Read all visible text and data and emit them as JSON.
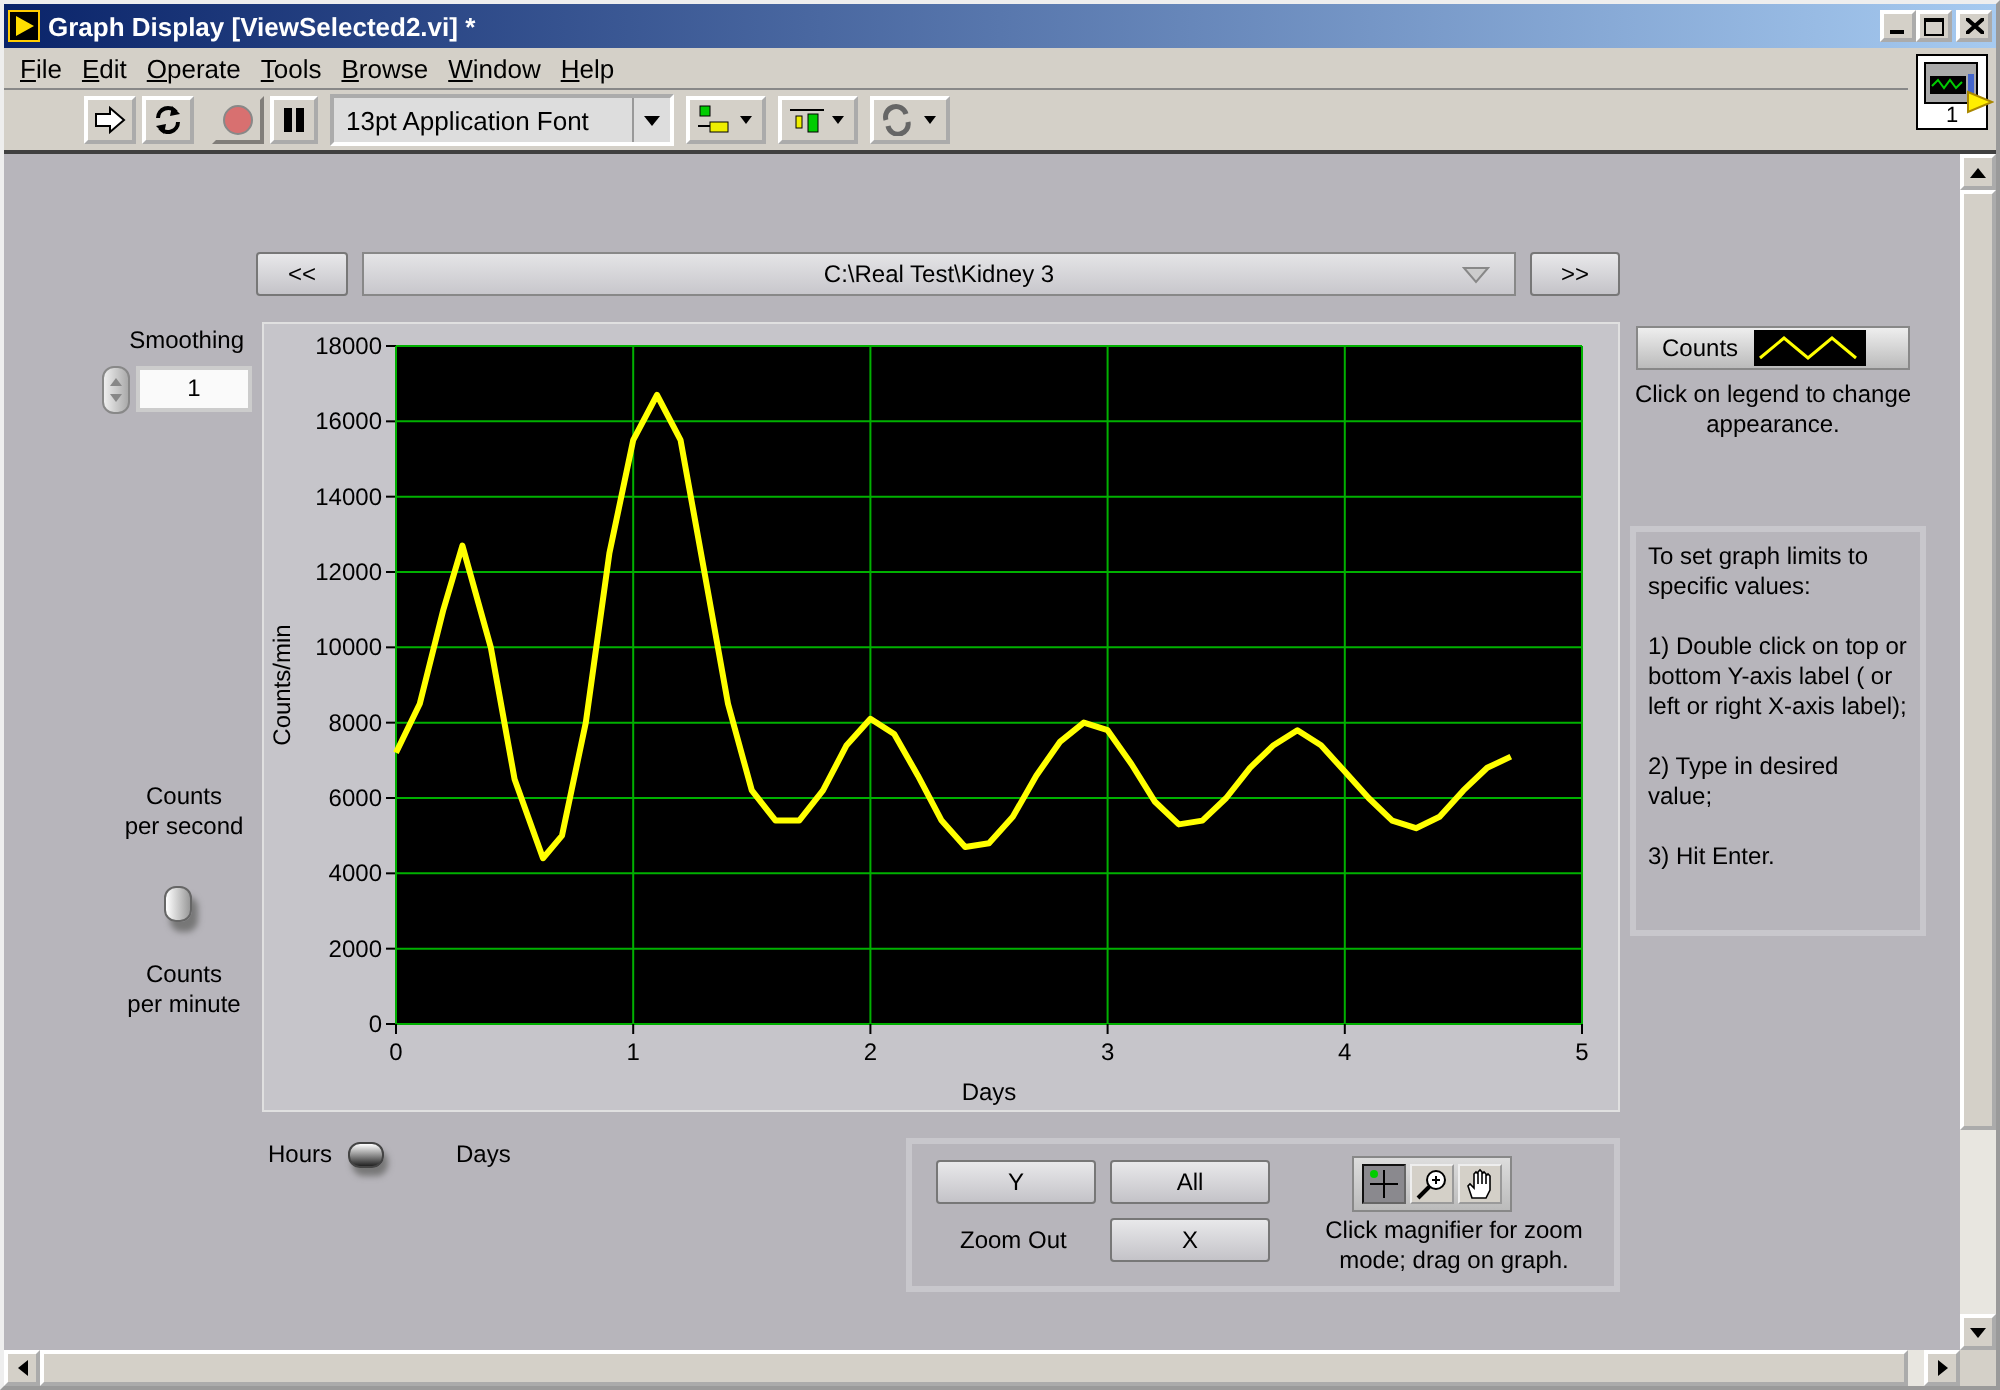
{
  "window": {
    "title": "Graph Display [ViewSelected2.vi] *"
  },
  "menu": [
    "File",
    "Edit",
    "Operate",
    "Tools",
    "Browse",
    "Window",
    "Help"
  ],
  "toolbar": {
    "font": "13pt Application Font",
    "running": false
  },
  "vi_icon": {
    "label": "1"
  },
  "navigator": {
    "prev": "<<",
    "path": "C:\\Real Test\\Kidney 3",
    "next": ">>"
  },
  "smoothing": {
    "label": "Smoothing",
    "value": "1"
  },
  "units_switch": {
    "top_label": "Counts\nper second",
    "bottom_label": "Counts\nper minute",
    "on": false
  },
  "time_switch": {
    "left_label": "Hours",
    "right_label": "Days",
    "on": false
  },
  "graph": {
    "chart_data": {
      "type": "line",
      "grid": true,
      "xlabel": "Days",
      "ylabel": "Counts/min",
      "xlim": [
        0,
        5
      ],
      "ylim": [
        0,
        18000
      ],
      "xticks": [
        0,
        1,
        2,
        3,
        4,
        5
      ],
      "yticks": [
        0,
        2000,
        4000,
        6000,
        8000,
        10000,
        12000,
        14000,
        16000,
        18000
      ],
      "x": [
        0,
        0.1,
        0.2,
        0.28,
        0.4,
        0.5,
        0.62,
        0.7,
        0.8,
        0.9,
        1.0,
        1.1,
        1.2,
        1.3,
        1.4,
        1.5,
        1.6,
        1.7,
        1.8,
        1.9,
        2.0,
        2.1,
        2.2,
        2.3,
        2.4,
        2.5,
        2.6,
        2.7,
        2.8,
        2.9,
        3.0,
        3.1,
        3.2,
        3.3,
        3.4,
        3.5,
        3.6,
        3.7,
        3.8,
        3.9,
        4.0,
        4.1,
        4.2,
        4.3,
        4.4,
        4.5,
        4.6,
        4.7
      ],
      "series": [
        {
          "name": "Counts",
          "color": "#ffff00",
          "values": [
            7200,
            8500,
            11000,
            12700,
            10000,
            6500,
            4400,
            5000,
            8000,
            12500,
            15500,
            16700,
            15500,
            12000,
            8500,
            6200,
            5400,
            5400,
            6200,
            7400,
            8100,
            7700,
            6600,
            5400,
            4700,
            4800,
            5500,
            6600,
            7500,
            8000,
            7800,
            6900,
            5900,
            5300,
            5400,
            6000,
            6800,
            7400,
            7800,
            7400,
            6700,
            6000,
            5400,
            5200,
            5500,
            6200,
            6800,
            7100
          ]
        }
      ]
    }
  },
  "legend": {
    "caption": "Click on legend to change appearance."
  },
  "notes": [
    "To set graph limits to specific values:",
    "1) Double click on top or bottom Y-axis label ( or left or right X-axis label);",
    "2)  Type in desired value;",
    "3) Hit Enter."
  ],
  "zoom": {
    "buttons": [
      "Y",
      "All",
      "X"
    ],
    "label": "Zoom Out",
    "tools": [
      {
        "kind": "cursor",
        "selected": true
      },
      {
        "kind": "zoom",
        "selected": false
      },
      {
        "kind": "pan",
        "selected": false
      }
    ],
    "caption": "Click magnifier for zoom mode; drag on graph."
  }
}
